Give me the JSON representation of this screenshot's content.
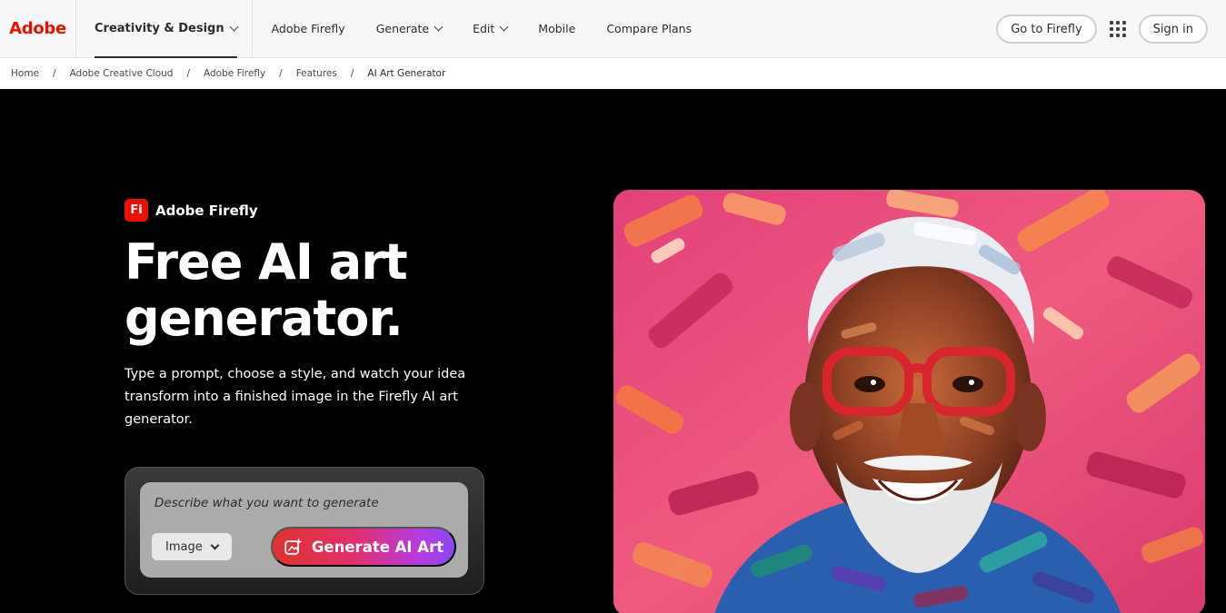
{
  "header": {
    "logo": "Adobe",
    "primary_nav": "Creativity & Design",
    "nav_items": [
      "Adobe Firefly",
      "Generate",
      "Edit",
      "Mobile",
      "Compare Plans"
    ],
    "go_to_firefly": "Go to Firefly",
    "sign_in": "Sign in",
    "apps_icon": "apps-grid-icon"
  },
  "breadcrumb": [
    "Home",
    "Adobe Creative Cloud",
    "Adobe Firefly",
    "Features",
    "AI Art Generator"
  ],
  "hero": {
    "brand_badge": "Fi",
    "brand_name": "Adobe Firefly",
    "title": "Free AI art generator.",
    "description": "Type a prompt, choose a style, and watch your idea transform into a finished image in the Firefly AI art generator.",
    "prompt_placeholder": "Describe what you want to generate",
    "type_select": "Image",
    "generate_button": "Generate AI Art",
    "generate_icon": "sparkle-image-icon"
  },
  "colors": {
    "adobe_red": "#eb1000",
    "hero_bg": "#000000",
    "button_gradient_start": "#e0322d",
    "button_gradient_end": "#8a47f0"
  }
}
